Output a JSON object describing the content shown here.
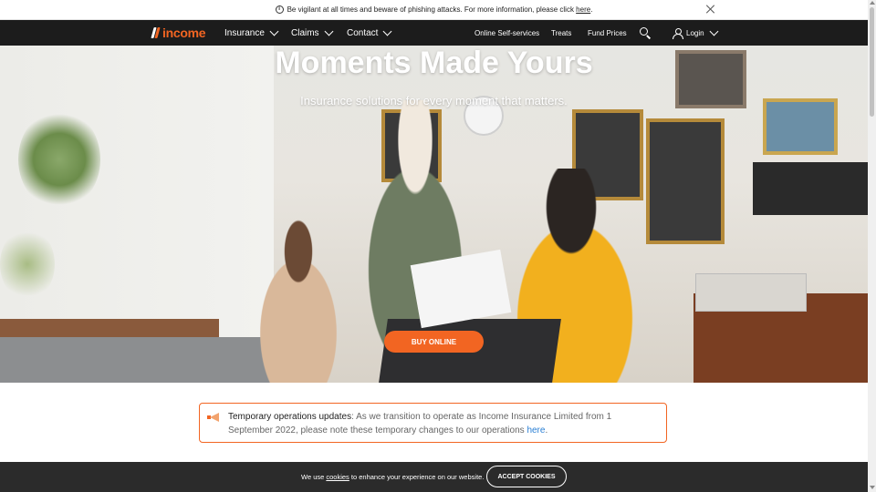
{
  "alert": {
    "text": "Be vigilant at all times and beware of phishing attacks. For more information, please click ",
    "link": "here",
    "end": "."
  },
  "nav": {
    "logo_text": "income",
    "items": [
      {
        "label": "Insurance"
      },
      {
        "label": "Claims"
      },
      {
        "label": "Contact"
      }
    ],
    "links": [
      {
        "label": "Online Self-services"
      },
      {
        "label": "Treats"
      },
      {
        "label": "Fund Prices"
      }
    ],
    "login_label": "Login"
  },
  "hero": {
    "title": "Moments Made Yours",
    "subtitle": "Insurance solutions for every moment that matters.",
    "button_label": "BUY ONLINE"
  },
  "notice": {
    "title": "Temporary operations updates",
    "text": ": As we transition to operate as Income Insurance Limited from 1 September 2022, please note these temporary changes to our operations ",
    "link": "here",
    "end": "."
  },
  "cookie": {
    "text_before": "We use ",
    "link": "cookies",
    "text_after": " to enhance your experience on our website.",
    "button_label": "ACCEPT COOKIES"
  },
  "colors": {
    "brand_orange": "#f26522",
    "nav_bg": "#1c1c1c",
    "cookie_bg": "#2b2b2b",
    "link_blue": "#2a7fd4"
  }
}
